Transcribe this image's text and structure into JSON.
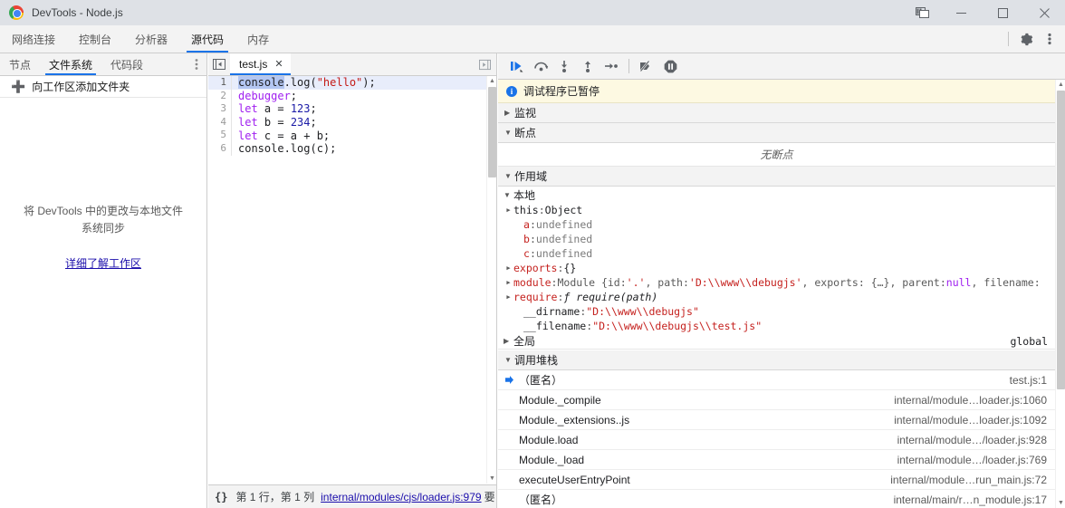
{
  "window": {
    "title": "DevTools - Node.js",
    "logo_icon": "chrome-logo",
    "dock_icon": "dock-side-icon",
    "minimize_icon": "minimize-icon",
    "maximize_icon": "maximize-icon",
    "close_icon": "close-icon"
  },
  "main_tabs": {
    "items": [
      {
        "label": "网络连接",
        "active": false
      },
      {
        "label": "控制台",
        "active": false
      },
      {
        "label": "分析器",
        "active": false
      },
      {
        "label": "源代码",
        "active": true
      },
      {
        "label": "内存",
        "active": false
      }
    ],
    "settings_icon": "gear-icon",
    "more_icon": "more-vertical-icon"
  },
  "navigator": {
    "tabs": [
      {
        "label": "节点",
        "active": false
      },
      {
        "label": "文件系统",
        "active": true
      },
      {
        "label": "代码段",
        "active": false
      }
    ],
    "more_icon": "more-vertical-icon",
    "add_folder": {
      "icon": "plus-icon",
      "label": "向工作区添加文件夹"
    },
    "empty_text": "将 DevTools 中的更改与本地文件系统同步",
    "empty_link": "详细了解工作区"
  },
  "editor": {
    "panel_toggle_left_icon": "show-navigator-icon",
    "panel_toggle_right_icon": "show-debugger-icon",
    "tab": {
      "name": "test.js",
      "close_icon": "close-icon"
    },
    "code_lines": [
      {
        "num": "1",
        "highlighted": true,
        "tokens": [
          {
            "text": "console",
            "cls": "tok-sel"
          },
          {
            "text": ".log(",
            "cls": "tok-plain"
          },
          {
            "text": "\"hello\"",
            "cls": "tok-str"
          },
          {
            "text": ");",
            "cls": "tok-plain"
          }
        ]
      },
      {
        "num": "2",
        "highlighted": false,
        "tokens": [
          {
            "text": "debugger",
            "cls": "tok-kw"
          },
          {
            "text": ";",
            "cls": "tok-plain"
          }
        ]
      },
      {
        "num": "3",
        "highlighted": false,
        "tokens": [
          {
            "text": "let",
            "cls": "tok-kw"
          },
          {
            "text": " a = ",
            "cls": "tok-plain"
          },
          {
            "text": "123",
            "cls": "tok-num"
          },
          {
            "text": ";",
            "cls": "tok-plain"
          }
        ]
      },
      {
        "num": "4",
        "highlighted": false,
        "tokens": [
          {
            "text": "let",
            "cls": "tok-kw"
          },
          {
            "text": " b = ",
            "cls": "tok-plain"
          },
          {
            "text": "234",
            "cls": "tok-num"
          },
          {
            "text": ";",
            "cls": "tok-plain"
          }
        ]
      },
      {
        "num": "5",
        "highlighted": false,
        "tokens": [
          {
            "text": "let",
            "cls": "tok-kw"
          },
          {
            "text": " c = a + b;",
            "cls": "tok-plain"
          }
        ]
      },
      {
        "num": "6",
        "highlighted": false,
        "tokens": [
          {
            "text": "console.log(c);",
            "cls": "tok-plain"
          }
        ]
      }
    ],
    "status": {
      "pretty_print": "{}",
      "cursor": "第 1 行，第 1 列",
      "link": "internal/modules/cjs/loader.js:979",
      "extra": "要"
    },
    "scrollbar": {
      "up_icon": "scroll-up-icon",
      "down_icon": "scroll-down-icon"
    }
  },
  "debugger": {
    "toolbar": [
      {
        "icon": "resume-script-execution-icon",
        "label": "恢复执行脚本",
        "active": true
      },
      {
        "icon": "step-over-icon",
        "label": "跳过下一个函数调用",
        "active": false
      },
      {
        "icon": "step-into-icon",
        "label": "步入下一个函数调用",
        "active": false
      },
      {
        "icon": "step-out-icon",
        "label": "步出当前函数",
        "active": false
      },
      {
        "icon": "step-icon",
        "label": "步进",
        "active": false
      }
    ],
    "deactivate_breakpoints_icon": "deactivate-breakpoints-icon",
    "pause_on_exceptions_icon": "pause-on-exceptions-icon",
    "paused_banner": {
      "icon": "info-icon",
      "text": "调试程序已暂停"
    },
    "sections": {
      "watch": {
        "label": "监视",
        "expanded": false
      },
      "breakpoints": {
        "label": "断点",
        "expanded": true,
        "empty_text": "无断点"
      },
      "scope": {
        "label": "作用域",
        "expanded": true
      },
      "call_stack": {
        "label": "调用堆栈",
        "expanded": true
      }
    },
    "scope": {
      "local_label": "本地",
      "global_label": "全局",
      "global_value": "global",
      "rows": [
        {
          "expandable": true,
          "indent": 1,
          "parts": [
            {
              "t": "this",
              "c": "sc-name-dark"
            },
            {
              "t": ": ",
              "c": "sc-gray"
            },
            {
              "t": "Object",
              "c": "sc-obj"
            }
          ]
        },
        {
          "expandable": false,
          "indent": 2,
          "parts": [
            {
              "t": "a",
              "c": "sc-name"
            },
            {
              "t": ": ",
              "c": "sc-gray"
            },
            {
              "t": "undefined",
              "c": "sc-undef"
            }
          ]
        },
        {
          "expandable": false,
          "indent": 2,
          "parts": [
            {
              "t": "b",
              "c": "sc-name"
            },
            {
              "t": ": ",
              "c": "sc-gray"
            },
            {
              "t": "undefined",
              "c": "sc-undef"
            }
          ]
        },
        {
          "expandable": false,
          "indent": 2,
          "parts": [
            {
              "t": "c",
              "c": "sc-name"
            },
            {
              "t": ": ",
              "c": "sc-gray"
            },
            {
              "t": "undefined",
              "c": "sc-undef"
            }
          ]
        },
        {
          "expandable": true,
          "indent": 1,
          "parts": [
            {
              "t": "exports",
              "c": "sc-name"
            },
            {
              "t": ": ",
              "c": "sc-gray"
            },
            {
              "t": "{}",
              "c": "sc-obj"
            }
          ]
        },
        {
          "expandable": true,
          "indent": 1,
          "parts": [
            {
              "t": "module",
              "c": "sc-name"
            },
            {
              "t": ": ",
              "c": "sc-gray"
            },
            {
              "t": "Module {id: ",
              "c": "sc-gray"
            },
            {
              "t": "'.'",
              "c": "sc-str"
            },
            {
              "t": ", path: ",
              "c": "sc-gray"
            },
            {
              "t": "'D:\\\\www\\\\debugjs'",
              "c": "sc-str"
            },
            {
              "t": ", exports: {…}, parent: ",
              "c": "sc-gray"
            },
            {
              "t": "null",
              "c": "sc-null"
            },
            {
              "t": ", filename:",
              "c": "sc-gray"
            }
          ]
        },
        {
          "expandable": true,
          "indent": 1,
          "parts": [
            {
              "t": "require",
              "c": "sc-name"
            },
            {
              "t": ": ",
              "c": "sc-gray"
            },
            {
              "t": "ƒ require(path)",
              "c": "sc-fn"
            }
          ]
        },
        {
          "expandable": false,
          "indent": 2,
          "parts": [
            {
              "t": "__dirname",
              "c": "sc-name-dark"
            },
            {
              "t": ": ",
              "c": "sc-gray"
            },
            {
              "t": "\"D:\\\\www\\\\debugjs\"",
              "c": "sc-str"
            }
          ]
        },
        {
          "expandable": false,
          "indent": 2,
          "parts": [
            {
              "t": "__filename",
              "c": "sc-name-dark"
            },
            {
              "t": ": ",
              "c": "sc-gray"
            },
            {
              "t": "\"D:\\\\www\\\\debugjs\\\\test.js\"",
              "c": "sc-str"
            }
          ]
        }
      ]
    },
    "call_stack": [
      {
        "name": "（匿名）",
        "location": "test.js:1",
        "selected": true
      },
      {
        "name": "Module._compile",
        "location": "internal/module…loader.js:1060",
        "selected": false
      },
      {
        "name": "Module._extensions..js",
        "location": "internal/module…loader.js:1092",
        "selected": false
      },
      {
        "name": "Module.load",
        "location": "internal/module…/loader.js:928",
        "selected": false
      },
      {
        "name": "Module._load",
        "location": "internal/module…/loader.js:769",
        "selected": false
      },
      {
        "name": "executeUserEntryPoint",
        "location": "internal/module…run_main.js:72",
        "selected": false
      },
      {
        "name": "（匿名）",
        "location": "internal/main/r…n_module.js:17",
        "selected": false
      }
    ],
    "scrollbar": {
      "up_icon": "scroll-up-icon",
      "down_icon": "scroll-down-icon"
    }
  },
  "colors": {
    "accent": "#1a73e8",
    "titlebar_bg": "#dee1e6",
    "toolbar_bg": "#f3f3f3",
    "paused_bg": "#fdf9e2",
    "link": "#1a0dab"
  }
}
